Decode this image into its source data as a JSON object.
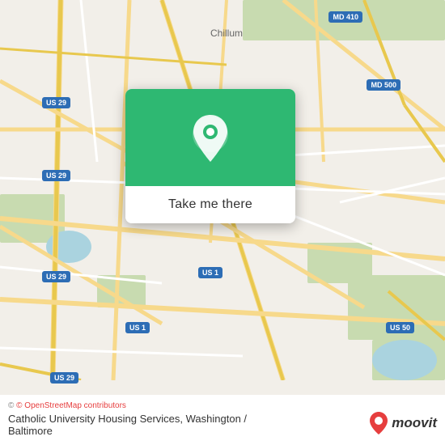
{
  "map": {
    "background_color": "#f2efe9",
    "location": "Catholic University Housing Services, Washington / Baltimore",
    "center": {
      "lat": 38.935,
      "lng": -77.0
    }
  },
  "popup": {
    "button_label": "Take me there",
    "header_color": "#2eb872"
  },
  "bottom_bar": {
    "copyright": "© OpenStreetMap contributors",
    "title": "Catholic University Housing Services, Washington /",
    "subtitle": "Baltimore"
  },
  "moovit": {
    "text": "moovit"
  },
  "shields": [
    {
      "id": "us29-1",
      "label": "US 29"
    },
    {
      "id": "us29-2",
      "label": "US 29"
    },
    {
      "id": "us29-3",
      "label": "US 29"
    },
    {
      "id": "us29-4",
      "label": "US 29"
    },
    {
      "id": "md410",
      "label": "MD 410"
    },
    {
      "id": "md500",
      "label": "MD 500"
    },
    {
      "id": "us1-1",
      "label": "US 1"
    },
    {
      "id": "us1-2",
      "label": "US 1"
    },
    {
      "id": "us50",
      "label": "US 50"
    }
  ]
}
